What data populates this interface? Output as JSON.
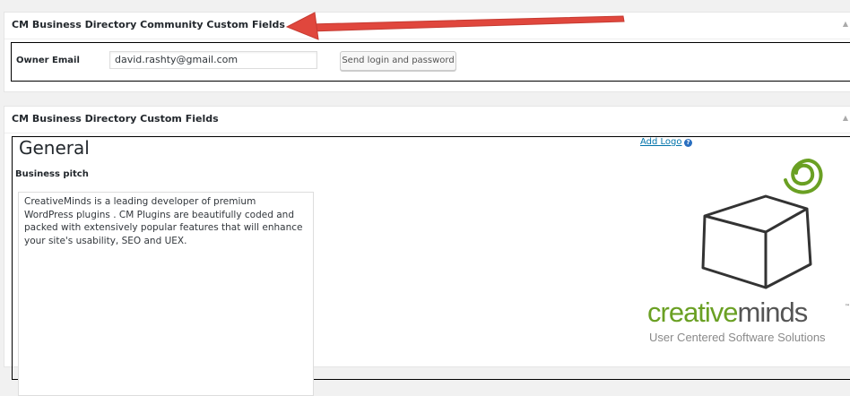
{
  "community_box": {
    "title": "CM Business Directory Community Custom Fields",
    "owner_email_label": "Owner Email",
    "owner_email_value": "david.rashty@gmail.com",
    "send_button_label": "Send login and password",
    "toggle_icon": "triangle-up-icon"
  },
  "custom_box": {
    "title": "CM Business Directory Custom Fields",
    "toggle_icon": "triangle-up-icon",
    "section_heading": "General",
    "pitch_label": "Business pitch",
    "pitch_text": "CreativeMinds is a leading developer of premium WordPress plugins . CM Plugins are beautifully coded and packed with extensively popular features that will enhance your site's usability, SEO and UEX.",
    "add_logo_label": "Add Logo",
    "help_icon": "question-icon",
    "logo": {
      "word_creative": "creative",
      "word_minds": "minds",
      "trademark": "™",
      "tagline": "User Centered Software Solutions",
      "green": "#6aa023",
      "gray": "#555555"
    }
  },
  "annotation": {
    "arrow_color": "#e0473d"
  }
}
